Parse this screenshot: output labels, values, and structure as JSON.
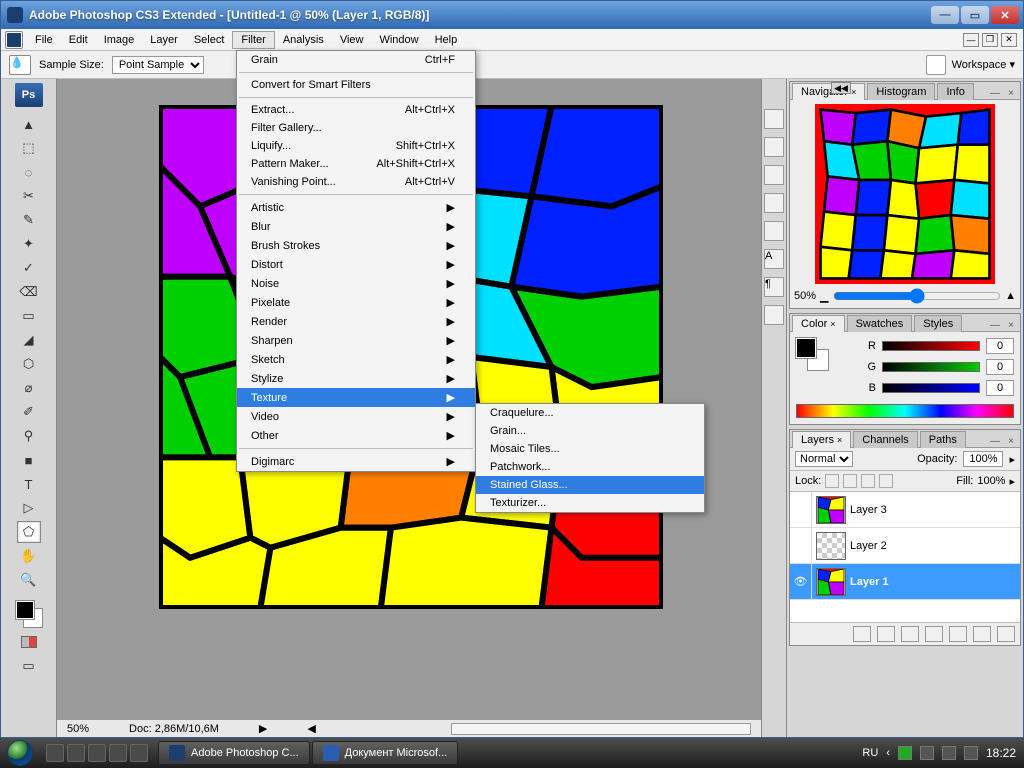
{
  "window": {
    "title": "Adobe Photoshop CS3 Extended - [Untitled-1 @ 50% (Layer 1, RGB/8)]"
  },
  "menubar": [
    "File",
    "Edit",
    "Image",
    "Layer",
    "Select",
    "Filter",
    "Analysis",
    "View",
    "Window",
    "Help"
  ],
  "menubar_open": "Filter",
  "optionbar": {
    "sample_label": "Sample Size:",
    "sample_value": "Point Sample",
    "workspace": "Workspace ▾"
  },
  "filter_menu": [
    {
      "label": "Grain",
      "shortcut": "Ctrl+F"
    },
    {
      "sep": true
    },
    {
      "label": "Convert for Smart Filters"
    },
    {
      "sep": true
    },
    {
      "label": "Extract...",
      "shortcut": "Alt+Ctrl+X"
    },
    {
      "label": "Filter Gallery..."
    },
    {
      "label": "Liquify...",
      "shortcut": "Shift+Ctrl+X"
    },
    {
      "label": "Pattern Maker...",
      "shortcut": "Alt+Shift+Ctrl+X"
    },
    {
      "label": "Vanishing Point...",
      "shortcut": "Alt+Ctrl+V"
    },
    {
      "sep": true
    },
    {
      "label": "Artistic",
      "sub": true
    },
    {
      "label": "Blur",
      "sub": true
    },
    {
      "label": "Brush Strokes",
      "sub": true
    },
    {
      "label": "Distort",
      "sub": true
    },
    {
      "label": "Noise",
      "sub": true
    },
    {
      "label": "Pixelate",
      "sub": true
    },
    {
      "label": "Render",
      "sub": true
    },
    {
      "label": "Sharpen",
      "sub": true
    },
    {
      "label": "Sketch",
      "sub": true
    },
    {
      "label": "Stylize",
      "sub": true
    },
    {
      "label": "Texture",
      "sub": true,
      "selected": true
    },
    {
      "label": "Video",
      "sub": true
    },
    {
      "label": "Other",
      "sub": true
    },
    {
      "sep": true
    },
    {
      "label": "Digimarc",
      "sub": true
    }
  ],
  "texture_submenu": [
    {
      "label": "Craquelure..."
    },
    {
      "label": "Grain..."
    },
    {
      "label": "Mosaic Tiles..."
    },
    {
      "label": "Patchwork..."
    },
    {
      "label": "Stained Glass...",
      "selected": true
    },
    {
      "label": "Texturizer..."
    }
  ],
  "tools": [
    "▲",
    "⬚",
    "◌",
    "✂",
    "✎",
    "✦",
    "✓",
    "⌫",
    "▭",
    "◢",
    "⬡",
    "⌀",
    "✐",
    "⚲",
    "■",
    "T",
    "▷",
    "⬠",
    "✋",
    "🔍"
  ],
  "navigator": {
    "tabs": [
      "Navigator",
      "Histogram",
      "Info"
    ],
    "zoom": "50%"
  },
  "color": {
    "tabs": [
      "Color",
      "Swatches",
      "Styles"
    ],
    "r": "0",
    "g": "0",
    "b": "0"
  },
  "layers": {
    "tabs": [
      "Layers",
      "Channels",
      "Paths"
    ],
    "blend": "Normal",
    "opacity_label": "Opacity:",
    "opacity": "100%",
    "lock_label": "Lock:",
    "fill_label": "Fill:",
    "fill": "100%",
    "items": [
      {
        "name": "Layer 3",
        "thumb": "stained",
        "visible": false
      },
      {
        "name": "Layer 2",
        "thumb": "check",
        "visible": false
      },
      {
        "name": "Layer 1",
        "thumb": "stained",
        "visible": true,
        "selected": true
      }
    ]
  },
  "status": {
    "zoom": "50%",
    "doc": "Doc: 2,86M/10,6M"
  },
  "taskbar": {
    "tasks": [
      {
        "label": "Adobe Photoshop C...",
        "app": "ps"
      },
      {
        "label": "Документ Microsof...",
        "app": "word"
      }
    ],
    "lang": "RU",
    "clock": "18:22"
  }
}
